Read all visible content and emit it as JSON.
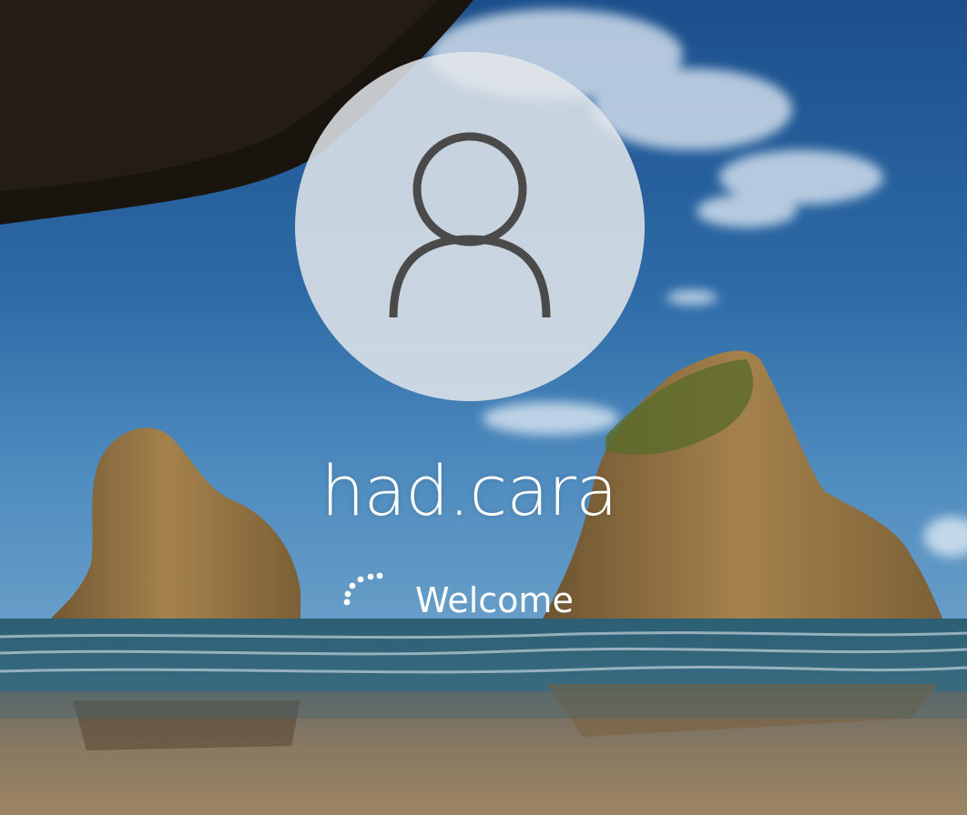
{
  "screen": "sign-in",
  "user": {
    "username": "had.cara",
    "avatar_icon": "user-icon"
  },
  "status": {
    "text": "Welcome",
    "indicator_icon": "loading-spinner-icon"
  },
  "colors": {
    "text": "#ffffff",
    "avatar_bg": "#e2e6ea",
    "avatar_icon": "#4a4a4a"
  }
}
